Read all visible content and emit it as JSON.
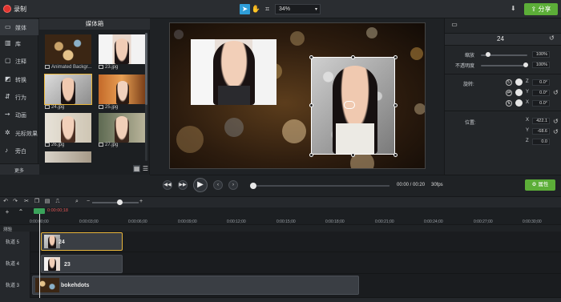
{
  "toolbar": {
    "record_label": "录制",
    "zoom_value": "34%",
    "share_label": "分享"
  },
  "sidebar": {
    "items": [
      {
        "label": "媒体",
        "icon": "film-icon"
      },
      {
        "label": "库",
        "icon": "library-icon"
      },
      {
        "label": "注释",
        "icon": "annotation-icon"
      },
      {
        "label": "转换",
        "icon": "transition-icon"
      },
      {
        "label": "行为",
        "icon": "behavior-icon"
      },
      {
        "label": "动画",
        "icon": "animation-icon"
      },
      {
        "label": "光标效果",
        "icon": "cursor-effect-icon"
      },
      {
        "label": "旁白",
        "icon": "microphone-icon"
      }
    ],
    "more_label": "更多"
  },
  "media_bin": {
    "title": "媒体箱",
    "items": [
      {
        "name": "Animated Backgr..."
      },
      {
        "name": "23.jpg"
      },
      {
        "name": "24.jpg"
      },
      {
        "name": "25.jpg"
      },
      {
        "name": "26.jpg"
      },
      {
        "name": "27.jpg"
      },
      {
        "name": ""
      }
    ]
  },
  "properties": {
    "title": "24",
    "scale_label": "缩放",
    "scale_value": "100%",
    "opacity_label": "不透明度",
    "opacity_value": "100%",
    "rotation_label": "旋转:",
    "rotation": [
      {
        "axis": "Z",
        "value": "0.0°"
      },
      {
        "axis": "Y",
        "value": "0.0°"
      },
      {
        "axis": "X",
        "value": "0.0°"
      }
    ],
    "position_label": "位置:",
    "position": [
      {
        "axis": "X",
        "value": "422.1"
      },
      {
        "axis": "Y",
        "value": "-68.6"
      },
      {
        "axis": "Z",
        "value": "0.0"
      }
    ],
    "properties_button": "属性"
  },
  "transport": {
    "timecode": "00:00 / 00:20",
    "fps": "30fps"
  },
  "timeline": {
    "playhead_time": "0:00:00;18",
    "ruler_ticks": [
      "0:00:00;00",
      "0:00:03;00",
      "0:00:06;00",
      "0:00:09;00",
      "0:00:12;00",
      "0:00:15;00",
      "0:00:18;00",
      "0:00:21;00",
      "0:00:24;00",
      "0:00:27;00",
      "0:00:30;00"
    ],
    "test_label": "测验",
    "tracks": [
      {
        "label": "轨道 5",
        "clip": "24"
      },
      {
        "label": "轨道 4",
        "clip": "23"
      },
      {
        "label": "轨道 3",
        "clip": "bokehdots"
      }
    ]
  },
  "colors": {
    "accent_green": "#5cae38",
    "selection_gold": "#e8b53a",
    "record_red": "#e0342f",
    "tool_blue": "#2f9ed8"
  }
}
